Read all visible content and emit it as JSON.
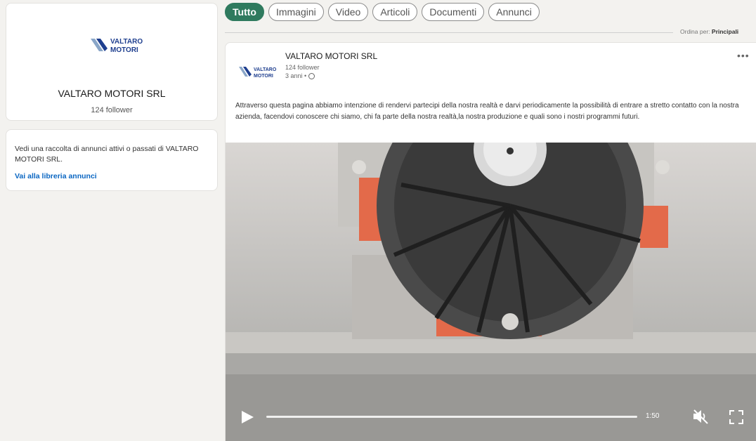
{
  "company": {
    "logo_line1": "VALTARO",
    "logo_line2": "MOTORI",
    "name": "VALTARO MOTORI SRL",
    "followers": "124 follower"
  },
  "ads": {
    "text": "Vedi una raccolta di annunci attivi o passati di VALTARO MOTORI SRL.",
    "link": "Vai alla libreria annunci"
  },
  "filters": {
    "tabs": [
      "Tutto",
      "Immagini",
      "Video",
      "Articoli",
      "Documenti",
      "Annunci"
    ],
    "active": "Tutto",
    "sort_prefix": "Ordina per:",
    "sort_value": "Principali"
  },
  "post": {
    "author": "VALTARO MOTORI SRL",
    "followers": "124 follower",
    "time": "3 anni •",
    "more": "•••",
    "text": "Attraverso questa pagina abbiamo intenzione di rendervi partecipi della nostra realtà e darvi periodicamente la possibilità di entrare a stretto contatto con la nostra azienda, facendovi conoscere chi siamo, chi fa parte della nostra realtà,la nostra produzione e quali sono i nostri programmi futuri."
  },
  "video": {
    "duration": "1:50",
    "progress": 0.0
  },
  "colors": {
    "accent": "#2f7a5e",
    "link": "#0a66c2",
    "logo_blue": "#1f3f8f"
  }
}
